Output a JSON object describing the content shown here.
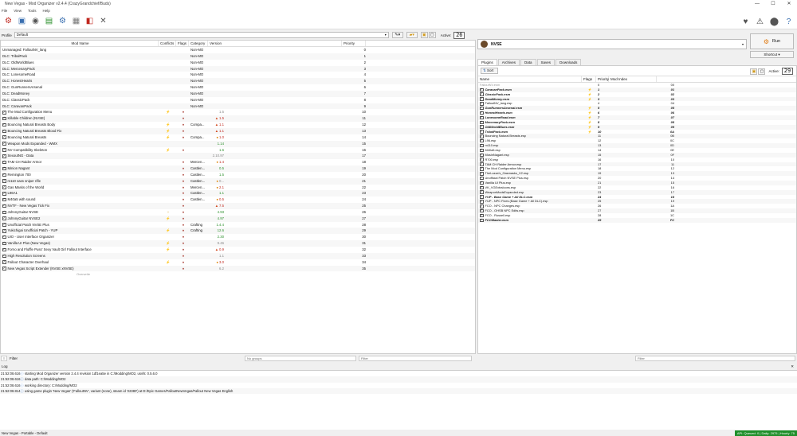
{
  "window": {
    "title": "New Vegas - Mod Organizer v2.4.4 (CrazyGrandchief/Buds)",
    "min": "—",
    "max": "☐",
    "close": "✕"
  },
  "menu": [
    "File",
    "View",
    "Tools",
    "Help"
  ],
  "profile": {
    "label": "Profile",
    "value": "Default",
    "active_label": "Active:",
    "active_count": "26"
  },
  "mod_columns": {
    "name": "Mod Name",
    "conflicts": "Conflicts",
    "flags": "Flags",
    "category": "Category",
    "version": "Version",
    "priority": "Priority"
  },
  "mods": [
    {
      "name": "Unmanaged: FalloutNV_lang",
      "cb": "",
      "conf": "",
      "flags": "",
      "cat": "Non-MO",
      "ver": "",
      "vc": "",
      "warn": "",
      "pri": "0"
    },
    {
      "name": "DLC: TribalPack",
      "cb": "",
      "conf": "",
      "flags": "",
      "cat": "Non-MO",
      "ver": "",
      "vc": "",
      "warn": "",
      "pri": "1"
    },
    {
      "name": "DLC: OldWorldBlues",
      "cb": "",
      "conf": "",
      "flags": "",
      "cat": "Non-MO",
      "ver": "",
      "vc": "",
      "warn": "",
      "pri": "2"
    },
    {
      "name": "DLC: MercenaryPack",
      "cb": "",
      "conf": "",
      "flags": "",
      "cat": "Non-MO",
      "ver": "",
      "vc": "",
      "warn": "",
      "pri": "3"
    },
    {
      "name": "DLC: LonesomeRoad",
      "cb": "",
      "conf": "",
      "flags": "",
      "cat": "Non-MO",
      "ver": "",
      "vc": "",
      "warn": "",
      "pri": "4"
    },
    {
      "name": "DLC: HonestHearts",
      "cb": "",
      "conf": "",
      "flags": "",
      "cat": "Non-MO",
      "ver": "",
      "vc": "",
      "warn": "",
      "pri": "5"
    },
    {
      "name": "DLC: GunRunnersArsenal",
      "cb": "",
      "conf": "",
      "flags": "",
      "cat": "Non-MO",
      "ver": "",
      "vc": "",
      "warn": "",
      "pri": "6"
    },
    {
      "name": "DLC: DeadMoney",
      "cb": "",
      "conf": "",
      "flags": "",
      "cat": "Non-MO",
      "ver": "",
      "vc": "",
      "warn": "",
      "pri": "7"
    },
    {
      "name": "DLC: ClassicPack",
      "cb": "",
      "conf": "",
      "flags": "",
      "cat": "Non-MO",
      "ver": "",
      "vc": "",
      "warn": "",
      "pri": "8"
    },
    {
      "name": "DLC: CaravanPack",
      "cb": "",
      "conf": "",
      "flags": "",
      "cat": "Non-MO",
      "ver": "",
      "vc": "",
      "warn": "",
      "pri": "9"
    },
    {
      "name": "The Mod Configuration Menu",
      "cb": "✓",
      "conf": "⚡",
      "flags": "♦",
      "cat": "",
      "ver": "1.5",
      "vc": "gray",
      "warn": "",
      "pri": "10"
    },
    {
      "name": "Killable Children (NVSE)",
      "cb": "✓",
      "conf": "",
      "flags": "♦",
      "cat": "",
      "ver": "1.5",
      "vc": "red",
      "warn": "▲",
      "pri": "11"
    },
    {
      "name": "Bouncing Natural Breasts Body",
      "cb": "✓",
      "conf": "⚡",
      "flags": "♦",
      "cat": "Compa...",
      "ver": "1.1",
      "vc": "red",
      "warn": "▲",
      "pri": "12"
    },
    {
      "name": "Bouncing Natural Breasts Blood Fix",
      "cb": "✓",
      "conf": "⚡",
      "flags": "♦",
      "cat": "",
      "ver": "1.1",
      "vc": "red",
      "warn": "▲",
      "pri": "13"
    },
    {
      "name": "Bouncing Natural Breasts",
      "cb": "✓",
      "conf": "⚡",
      "flags": "♦",
      "cat": "Compa...",
      "ver": "1.0",
      "vc": "red",
      "warn": "●",
      "pri": "14"
    },
    {
      "name": "Weapon Mods Expanded - WMX",
      "cb": "✓",
      "conf": "",
      "flags": "",
      "cat": "",
      "ver": "1.14",
      "vc": "green",
      "warn": "",
      "pri": "15"
    },
    {
      "name": "NV Compatibility Skeleton",
      "cb": "✓",
      "conf": "⚡",
      "flags": "♦",
      "cat": "",
      "ver": "1.6",
      "vc": "green",
      "warn": "",
      "pri": "16"
    },
    {
      "name": "SexoutNG - Data",
      "cb": "✓",
      "conf": "",
      "flags": "",
      "cat": "",
      "ver": "2.10.97",
      "vc": "gray",
      "warn": "",
      "pri": "17"
    },
    {
      "name": "TAM CH Raider Armor",
      "cb": "✓",
      "conf": "",
      "flags": "♦",
      "cat": "Mercen...",
      "ver": "1.4",
      "vc": "red",
      "warn": "●",
      "pri": "18"
    },
    {
      "name": "Minion Nagant",
      "cb": "✓",
      "conf": "",
      "flags": "♦",
      "cat": "Castlen...",
      "ver": "0.5",
      "vc": "green",
      "warn": "",
      "pri": "19"
    },
    {
      "name": "Remington 700",
      "cb": "✓",
      "conf": "",
      "flags": "♦",
      "cat": "Castlen...",
      "ver": "1.5",
      "vc": "green",
      "warn": "",
      "pri": "20"
    },
    {
      "name": "m110 sass sniper rifle",
      "cb": "✓",
      "conf": "",
      "flags": "♦",
      "cat": "Castlen...",
      "ver": "0...",
      "vc": "gray",
      "warn": "●",
      "pri": "21"
    },
    {
      "name": "Gas Masks of the World",
      "cb": "✓",
      "conf": "",
      "flags": "♦",
      "cat": "Mercen...",
      "ver": "2.1",
      "vc": "red",
      "warn": "●",
      "pri": "22"
    },
    {
      "name": "L96A1",
      "cb": "✓",
      "conf": "",
      "flags": "♦",
      "cat": "Castlen...",
      "ver": "1.1",
      "vc": "green",
      "warn": "",
      "pri": "23"
    },
    {
      "name": "M40a5 with sound",
      "cb": "✓",
      "conf": "",
      "flags": "♦",
      "cat": "Castlen...",
      "ver": "0.5",
      "vc": "red",
      "warn": "●",
      "pri": "24"
    },
    {
      "name": "NVTF - New Vegas Tick Fix",
      "cb": "✓",
      "conf": "",
      "flags": "♦",
      "cat": "",
      "ver": "7.5",
      "vc": "red",
      "warn": "▲",
      "pri": "25"
    },
    {
      "name": "JohnnyGuitar NVSE",
      "cb": "✓",
      "conf": "♀",
      "flags": "♦",
      "cat": "",
      "ver": "4.93",
      "vc": "green",
      "warn": "",
      "pri": "26"
    },
    {
      "name": "JohnnyGuitar NVSE2",
      "cb": "✓",
      "conf": "⚡",
      "flags": "♦",
      "cat": "",
      "ver": "4.97",
      "vc": "green",
      "warn": "",
      "pri": "27"
    },
    {
      "name": "Unofficial Patch NVSE Plus",
      "cb": "✓",
      "conf": "",
      "flags": "♦",
      "cat": "Crafting",
      "ver": "1.4.4",
      "vc": "green",
      "warn": "",
      "pri": "28"
    },
    {
      "name": "Yukichigai Unofficial Patch - YUP",
      "cb": "✓",
      "conf": "⚡",
      "flags": "♦",
      "cat": "Crafting",
      "ver": "12.6",
      "vc": "green",
      "warn": "",
      "pri": "29"
    },
    {
      "name": "UIO - User Interface Organizer",
      "cb": "✓",
      "conf": "",
      "flags": "♦",
      "cat": "",
      "ver": "2.30",
      "vc": "green",
      "warn": "",
      "pri": "30"
    },
    {
      "name": "Vanilla UI Plus (New Vegas)",
      "cb": "✓",
      "conf": "⚡",
      "flags": "♦",
      "cat": "",
      "ver": "9.46",
      "vc": "gray",
      "warn": "",
      "pri": "31"
    },
    {
      "name": "Forno and Fluffle Puss' Sexy Vault Girl Fallout Interface",
      "cb": "✓",
      "conf": "⚡",
      "flags": "♦",
      "cat": "",
      "ver": "0.9",
      "vc": "red",
      "warn": "▲",
      "pri": "32"
    },
    {
      "name": "High Resolution Screens",
      "cb": "✓",
      "conf": "",
      "flags": "♦",
      "cat": "",
      "ver": "1.1",
      "vc": "gray",
      "warn": "",
      "pri": "33"
    },
    {
      "name": "Fallout Character Overhaul",
      "cb": "✓",
      "conf": "⚡",
      "flags": "♦",
      "cat": "",
      "ver": "3.0",
      "vc": "red",
      "warn": "●",
      "pri": "34"
    },
    {
      "name": "New Vegas Script Extender (NVSE xNVSE)",
      "cb": "✓",
      "conf": "",
      "flags": "♦",
      "cat": "",
      "ver": "6.2",
      "vc": "gray",
      "warn": "",
      "pri": "35"
    }
  ],
  "overwrite_label": "Overwrite",
  "left_filter": {
    "label": "Filter",
    "groups": "No groups",
    "placeholder": "Filter"
  },
  "executable": {
    "name": "NVSE",
    "run": "Run",
    "shortcut": "Shortcut"
  },
  "tabs": [
    "Plugins",
    "Archives",
    "Data",
    "Saves",
    "Downloads"
  ],
  "plugins_bar": {
    "sort": "Sort",
    "active_label": "Active:",
    "active_count": "29"
  },
  "plugin_columns": {
    "name": "Name",
    "flags": "Flags",
    "priority": "Priority",
    "index": "Mod Index"
  },
  "plugins": [
    {
      "name": "FalloutNV.esm",
      "cb": false,
      "bi": false,
      "flag": "",
      "pri": "0",
      "idx": "00",
      "gray": true
    },
    {
      "name": "CaravanPack.esm",
      "cb": true,
      "bi": true,
      "flag": "⚡",
      "pri": "1",
      "idx": "01"
    },
    {
      "name": "ClassicPack.esm",
      "cb": true,
      "bi": true,
      "flag": "⚡",
      "pri": "2",
      "idx": "02"
    },
    {
      "name": "DeadMoney.esm",
      "cb": true,
      "bi": true,
      "flag": "⚡",
      "pri": "3",
      "idx": "03"
    },
    {
      "name": "FalloutNV_lang.esp",
      "cb": true,
      "bi": false,
      "flag": "",
      "pri": "4",
      "idx": "04"
    },
    {
      "name": "GunRunnersArsenal.esm",
      "cb": true,
      "bi": true,
      "flag": "⚡",
      "pri": "5",
      "idx": "05"
    },
    {
      "name": "HonestHearts.esm",
      "cb": true,
      "bi": true,
      "flag": "⚡",
      "pri": "6",
      "idx": "06"
    },
    {
      "name": "LonesomeRoad.esm",
      "cb": true,
      "bi": true,
      "flag": "⚡",
      "pri": "7",
      "idx": "07"
    },
    {
      "name": "MercenaryPack.esm",
      "cb": true,
      "bi": true,
      "flag": "⚡",
      "pri": "8",
      "idx": "08"
    },
    {
      "name": "OldWorldBlues.esm",
      "cb": true,
      "bi": true,
      "flag": "⚡",
      "pri": "9",
      "idx": "09"
    },
    {
      "name": "TribalPack.esm",
      "cb": true,
      "bi": true,
      "flag": "⚡",
      "pri": "10",
      "idx": "0A"
    },
    {
      "name": "Bouncing Natural Breasts.esp",
      "cb": true,
      "bi": false,
      "flag": "",
      "pri": "11",
      "idx": "0B"
    },
    {
      "name": "L96.esp",
      "cb": true,
      "bi": false,
      "flag": "",
      "pri": "12",
      "idx": "0C"
    },
    {
      "name": "m110.esp",
      "cb": true,
      "bi": false,
      "flag": "",
      "pri": "13",
      "idx": "0D"
    },
    {
      "name": "M40a5.esp",
      "cb": true,
      "bi": false,
      "flag": "",
      "pri": "14",
      "idx": "0E"
    },
    {
      "name": "MosinNagant.esp",
      "cb": true,
      "bi": false,
      "flag": "",
      "pri": "15",
      "idx": "0F"
    },
    {
      "name": "R700.esp",
      "cb": true,
      "bi": false,
      "flag": "",
      "pri": "16",
      "idx": "10"
    },
    {
      "name": "TAM CH Raider Armor.esp",
      "cb": true,
      "bi": false,
      "flag": "",
      "pri": "17",
      "idx": "11"
    },
    {
      "name": "The Mod Configuration Menu.esp",
      "cb": true,
      "bi": false,
      "flag": "",
      "pri": "18",
      "idx": "12"
    },
    {
      "name": "TheLozza's_Gasmasks_V2.esp",
      "cb": true,
      "bi": false,
      "flag": "",
      "pri": "19",
      "idx": "13"
    },
    {
      "name": "Unofficial Patch NVSE Plus.esp",
      "cb": true,
      "bi": false,
      "flag": "",
      "pri": "20",
      "idx": "14"
    },
    {
      "name": "Vanilla UI Plus.esp",
      "cb": true,
      "bi": false,
      "flag": "",
      "pri": "21",
      "idx": "15"
    },
    {
      "name": "VK_VGExtraIcons.esp",
      "cb": true,
      "bi": false,
      "flag": "",
      "pri": "22",
      "idx": "16"
    },
    {
      "name": "WeaponModsExpanded.esp",
      "cb": true,
      "bi": false,
      "flag": "",
      "pri": "23",
      "idx": "17"
    },
    {
      "name": "YUP - Base Game + All DLC.esm",
      "cb": true,
      "bi": true,
      "flag": "",
      "pri": "24",
      "idx": "18"
    },
    {
      "name": "YUP - NPC Fixes (Base Game + All DLC).esp",
      "cb": true,
      "bi": false,
      "flag": "",
      "pri": "25",
      "idx": "19"
    },
    {
      "name": "FCO - NPC Changes.esp",
      "cb": true,
      "bi": false,
      "flag": "",
      "pri": "26",
      "idx": "1A"
    },
    {
      "name": "FCO - OHSB NPC Edits.esp",
      "cb": true,
      "bi": false,
      "flag": "",
      "pri": "27",
      "idx": "1B"
    },
    {
      "name": "FCO - Russell.esp",
      "cb": true,
      "bi": false,
      "flag": "",
      "pri": "28",
      "idx": "1C"
    },
    {
      "name": "FCOMaster.esm",
      "cb": true,
      "bi": true,
      "flag": "",
      "pri": "29",
      "idx": "FC"
    }
  ],
  "right_filter": {
    "placeholder": "Filter"
  },
  "log_label": "Log",
  "log": [
    {
      "t": "21:52:08.616",
      "m": "starting Mod Organizer version 2.4.4 revision 1df1ea5e in C:/Modding/MO2, usvfs: 0.5.6.0"
    },
    {
      "t": "21:52:08.616",
      "m": "data path: C:/Modding/MO2"
    },
    {
      "t": "21:52:08.616",
      "m": "working directory: C:/Modding/MO2"
    },
    {
      "t": "21:52:08.814",
      "m": "using game plugin 'New Vegas' ('FalloutNV', variant (none), steam id '22380') at D:/Epic Games/FalloutNewVegas/Fallout New Vegas English"
    }
  ],
  "status": {
    "left": "New Vegas - Portable - Default",
    "right": "API: Queued: 0 | Daily: 2975 | Hourly: 75"
  }
}
